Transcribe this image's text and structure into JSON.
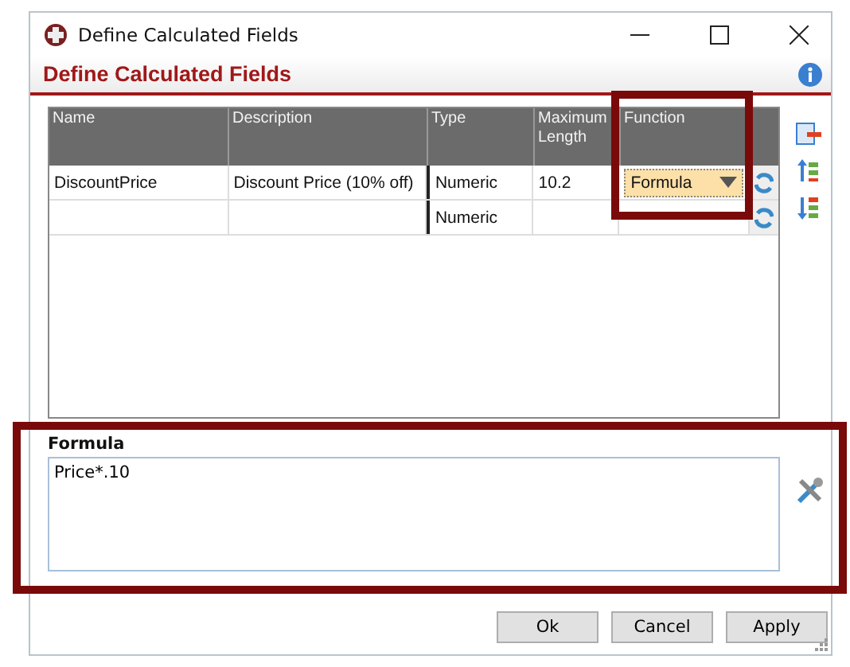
{
  "window": {
    "title": "Define Calculated Fields"
  },
  "header": {
    "title": "Define Calculated Fields"
  },
  "grid": {
    "columns": [
      "Name",
      "Description",
      "Type",
      "Maximum Length",
      "Function"
    ],
    "rows": [
      {
        "cells": [
          "DiscountPrice",
          "Discount Price (10% off)",
          "Numeric",
          "10.2",
          "Formula"
        ],
        "editing": true
      },
      {
        "cells": [
          "",
          "",
          "Numeric",
          "",
          ""
        ],
        "editing": false
      }
    ]
  },
  "formula": {
    "label": "Formula",
    "value": "Price*.10"
  },
  "buttons": [
    "Ok",
    "Cancel",
    "Apply"
  ]
}
